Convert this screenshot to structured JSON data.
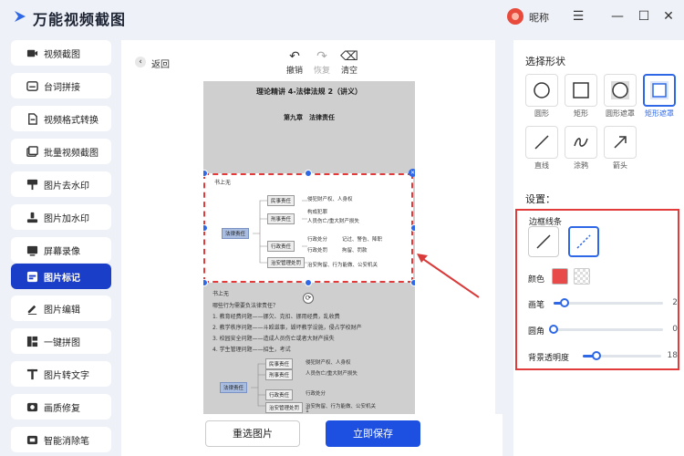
{
  "app": {
    "title": "万能视频截图",
    "user_name": "昵称"
  },
  "sidebar": {
    "items": [
      {
        "label": "视频截图",
        "icon": "video-icon"
      },
      {
        "label": "台词拼接",
        "icon": "subtitle-icon"
      },
      {
        "label": "视频格式转换",
        "icon": "convert-icon"
      },
      {
        "label": "批量视频截图",
        "icon": "batch-icon"
      },
      {
        "label": "图片去水印",
        "icon": "remove-watermark-icon"
      },
      {
        "label": "图片加水印",
        "icon": "add-watermark-icon"
      },
      {
        "label": "屏幕录像",
        "icon": "record-icon"
      },
      {
        "label": "图片标记",
        "icon": "mark-icon"
      },
      {
        "label": "图片编辑",
        "icon": "edit-icon"
      },
      {
        "label": "一键拼图",
        "icon": "collage-icon"
      },
      {
        "label": "图片转文字",
        "icon": "ocr-icon"
      },
      {
        "label": "画质修复",
        "icon": "enhance-icon"
      },
      {
        "label": "智能消除笔",
        "icon": "eraser-icon"
      }
    ],
    "active_index": 7
  },
  "editor": {
    "back_label": "返回",
    "toolbar": {
      "undo": "撤销",
      "redo": "恢复",
      "clear": "清空"
    },
    "doc": {
      "title": "理论精讲 4-法律法规 2（讲义）",
      "chapter": "第九章　法律责任",
      "note1": "书上无",
      "note2": "书上无",
      "question": "哪些行为需要负法律责任？",
      "lines": [
        "1. 教育经费问题——挪欠、克扣、挪用经费，乱收费",
        "2. 教学秩序问题——斗殴滋事，毁坏教学设施，侵占学校财产",
        "3. 校园安全问题——造成人员伤亡或者大财产损失",
        "4. 学生管理问题——招生，考试"
      ],
      "mindmap": {
        "root": "法律责任",
        "branches": [
          "民事责任",
          "刑事责任",
          "行政责任",
          "治安管理处罚"
        ],
        "leaves": [
          "侵犯财产权、人身权",
          "构成犯罪",
          "人员伤亡/重大财产损失",
          "行政处分",
          "记过、警告、降职",
          "行政处罚",
          "拘留、罚款",
          "治安拘留、行为能做、公安机关"
        ]
      },
      "page_number": "1"
    },
    "buttons": {
      "reselect": "重选图片",
      "save": "立即保存"
    }
  },
  "panel": {
    "shape_title": "选择形状",
    "shapes": [
      {
        "label": "圆形",
        "icon": "circle-icon"
      },
      {
        "label": "矩形",
        "icon": "rectangle-icon"
      },
      {
        "label": "圆形遮罩",
        "icon": "circle-mask-icon"
      },
      {
        "label": "矩形遮罩",
        "icon": "rect-mask-icon"
      },
      {
        "label": "直线",
        "icon": "line-icon"
      },
      {
        "label": "涂鸦",
        "icon": "scribble-icon"
      },
      {
        "label": "箭头",
        "icon": "arrow-icon"
      }
    ],
    "active_shape": 3,
    "settings_title": "设置：",
    "border_label": "边框线条",
    "color_label": "颜色",
    "selected_color": "#e84a4a",
    "sliders": [
      {
        "label": "画笔",
        "value": 2,
        "max": 20
      },
      {
        "label": "圆角",
        "value": 0,
        "max": 20
      },
      {
        "label": "背景透明度",
        "value": 18,
        "max": 100
      }
    ],
    "accent": "#2f68e6",
    "highlight": "#e23b3b"
  }
}
